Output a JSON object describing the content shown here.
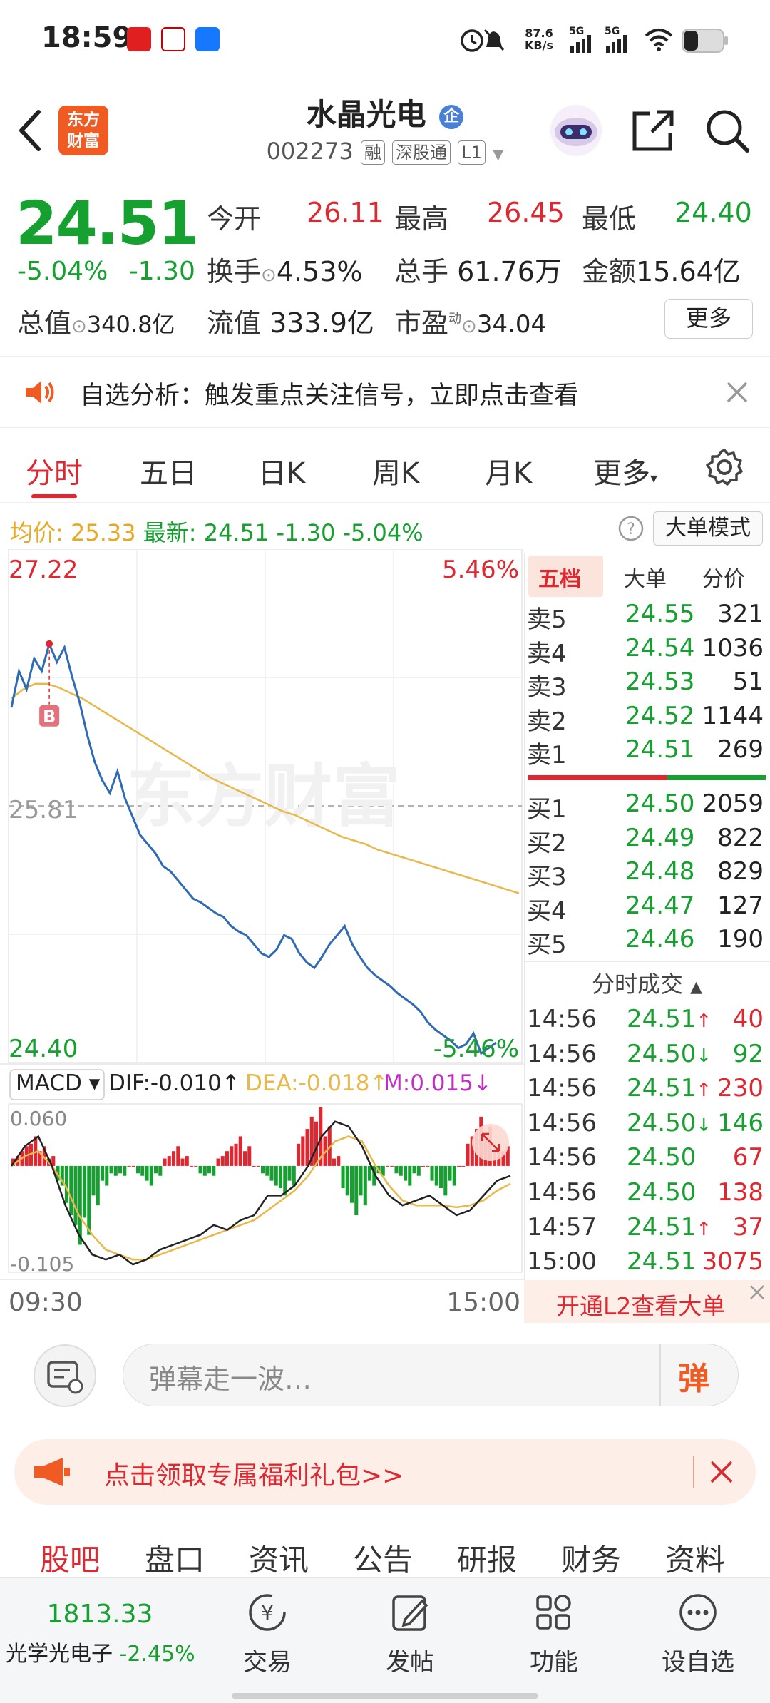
{
  "status_bar": {
    "time": "18:59",
    "net_speed": "87.6",
    "net_unit": "KB/s",
    "signal1": "5G",
    "signal2": "5G"
  },
  "header": {
    "logo_line1": "东方",
    "logo_line2": "财富",
    "stock_name": "水晶光电",
    "badge": "企",
    "stock_code": "002273",
    "tags": [
      "融",
      "深股通",
      "L1"
    ]
  },
  "quote": {
    "price": "24.51",
    "change_pct": "-5.04%",
    "change_amt": "-1.30",
    "open_label": "今开",
    "open": "26.11",
    "high_label": "最高",
    "high": "26.45",
    "low_label": "最低",
    "low": "24.40",
    "turnover_label": "换手",
    "turnover": "4.53%",
    "volume_label": "总手",
    "volume": "61.76万",
    "amount_label": "金额",
    "amount": "15.64亿",
    "mktcap_label": "总值",
    "mktcap": "340.8亿",
    "float_label": "流值",
    "float": "333.9亿",
    "pe_label": "市盈",
    "pe_sup": "动",
    "pe": "34.04",
    "more_label": "更多"
  },
  "notice": {
    "text": "自选分析：触发重点关注信号，立即点击查看"
  },
  "chart_tabs": {
    "items": [
      "分时",
      "五日",
      "日K",
      "周K",
      "月K",
      "更多"
    ],
    "active": 0
  },
  "avg_row": {
    "avg_label": "均价:",
    "avg_value": "25.33",
    "latest_label": "最新:",
    "latest_value": "24.51",
    "latest_chg": "-1.30",
    "latest_pct": "-5.04%",
    "big_order_mode": "大单模式"
  },
  "chart_data": [
    {
      "type": "line",
      "series": [],
      "y_top_label": "27.22",
      "y_mid_label": "25.81",
      "y_bottom_label": "24.40",
      "pct_top_label": "5.46%",
      "pct_bottom_label": "-5.46%",
      "ylim": [
        24.4,
        27.22
      ],
      "x_start_label": "09:30",
      "x_end_label": "15:00",
      "marker_label": "B",
      "watermark": "东方财富",
      "price_series": [
        26.35,
        26.55,
        26.45,
        26.62,
        26.55,
        26.7,
        26.6,
        26.68,
        26.52,
        26.38,
        26.2,
        26.05,
        25.95,
        25.88,
        26.0,
        25.85,
        25.75,
        25.65,
        25.6,
        25.55,
        25.48,
        25.45,
        25.4,
        25.35,
        25.3,
        25.28,
        25.25,
        25.22,
        25.2,
        25.15,
        25.12,
        25.1,
        25.05,
        25.0,
        24.98,
        25.02,
        25.1,
        25.08,
        25.0,
        24.95,
        24.92,
        24.98,
        25.05,
        25.1,
        25.15,
        25.05,
        24.98,
        24.92,
        24.88,
        24.85,
        24.82,
        24.78,
        24.75,
        24.72,
        24.68,
        24.62,
        24.58,
        24.55,
        24.52,
        24.48,
        24.5,
        24.56,
        24.45,
        24.48,
        24.51
      ],
      "avg_series": [
        26.4,
        26.45,
        26.48,
        26.48,
        26.46,
        26.43,
        26.4,
        26.36,
        26.32,
        26.28,
        26.24,
        26.2,
        26.16,
        26.12,
        26.08,
        26.04,
        26.0,
        25.96,
        25.93,
        25.9,
        25.87,
        25.84,
        25.81,
        25.78,
        25.76,
        25.73,
        25.7,
        25.67,
        25.64,
        25.62,
        25.6,
        25.57,
        25.55,
        25.53,
        25.51,
        25.49,
        25.47,
        25.45,
        25.43,
        25.41,
        25.39,
        25.37,
        25.35,
        25.33
      ]
    },
    {
      "type": "bar",
      "series": [],
      "indicator": "MACD",
      "dif_label": "DIF:-0.010↑",
      "dea_label": "DEA:-0.018↑",
      "m_label": "M:0.015↓",
      "y_top_label": "0.060",
      "y_bottom_label": "-0.105",
      "ylim": [
        -0.105,
        0.06
      ],
      "macd_values": [
        0.01,
        0.02,
        0.03,
        0.02,
        0.01,
        -0.02,
        -0.05,
        -0.08,
        -0.07,
        -0.04,
        -0.02,
        -0.01,
        -0.01,
        0.0,
        -0.01,
        -0.02,
        -0.01,
        0.01,
        0.02,
        0.01,
        0.0,
        -0.01,
        -0.01,
        0.01,
        0.02,
        0.03,
        0.02,
        0.0,
        -0.01,
        -0.02,
        -0.03,
        -0.02,
        0.03,
        0.05,
        0.06,
        0.04,
        0.01,
        -0.03,
        -0.05,
        -0.04,
        -0.02,
        -0.01,
        0.0,
        -0.01,
        -0.02,
        -0.01,
        0.0,
        -0.02,
        -0.03,
        -0.02,
        0.0,
        0.03,
        0.05,
        0.04,
        0.02,
        0.02
      ],
      "dif_series": [
        0.0,
        0.02,
        0.03,
        0.0,
        -0.04,
        -0.07,
        -0.09,
        -0.095,
        -0.09,
        -0.1,
        -0.095,
        -0.085,
        -0.08,
        -0.075,
        -0.07,
        -0.06,
        -0.065,
        -0.055,
        -0.05,
        -0.03,
        -0.03,
        -0.02,
        0.0,
        0.03,
        0.045,
        0.04,
        0.02,
        -0.01,
        -0.03,
        -0.04,
        -0.035,
        -0.03,
        -0.04,
        -0.05,
        -0.045,
        -0.03,
        -0.015,
        -0.01
      ],
      "dea_series": [
        0.0,
        0.01,
        0.015,
        0.0,
        -0.02,
        -0.05,
        -0.07,
        -0.085,
        -0.09,
        -0.095,
        -0.095,
        -0.09,
        -0.085,
        -0.08,
        -0.075,
        -0.07,
        -0.065,
        -0.06,
        -0.055,
        -0.045,
        -0.035,
        -0.025,
        -0.01,
        0.01,
        0.025,
        0.03,
        0.025,
        0.0,
        -0.02,
        -0.035,
        -0.04,
        -0.04,
        -0.04,
        -0.042,
        -0.04,
        -0.035,
        -0.025,
        -0.018
      ]
    }
  ],
  "panel": {
    "tabs": [
      "五档",
      "大单",
      "分价"
    ],
    "sells": [
      {
        "label": "卖5",
        "price": "24.55",
        "vol": "321"
      },
      {
        "label": "卖4",
        "price": "24.54",
        "vol": "1036"
      },
      {
        "label": "卖3",
        "price": "24.53",
        "vol": "51"
      },
      {
        "label": "卖2",
        "price": "24.52",
        "vol": "1144"
      },
      {
        "label": "卖1",
        "price": "24.51",
        "vol": "269"
      }
    ],
    "buys": [
      {
        "label": "买1",
        "price": "24.50",
        "vol": "2059"
      },
      {
        "label": "买2",
        "price": "24.49",
        "vol": "822"
      },
      {
        "label": "买3",
        "price": "24.48",
        "vol": "829"
      },
      {
        "label": "买4",
        "price": "24.47",
        "vol": "127"
      },
      {
        "label": "买5",
        "price": "24.46",
        "vol": "190"
      }
    ],
    "ticks_title": "分时成交",
    "ticks": [
      {
        "time": "14:56",
        "price": "24.51",
        "arrow": "↑",
        "vol": "40",
        "color": "#e0262e"
      },
      {
        "time": "14:56",
        "price": "24.50",
        "arrow": "↓",
        "vol": "92",
        "color": "#15a030"
      },
      {
        "time": "14:56",
        "price": "24.51",
        "arrow": "↑",
        "vol": "230",
        "color": "#e0262e"
      },
      {
        "time": "14:56",
        "price": "24.50",
        "arrow": "↓",
        "vol": "146",
        "color": "#15a030"
      },
      {
        "time": "14:56",
        "price": "24.50",
        "arrow": "",
        "vol": "67",
        "color": "#e0262e"
      },
      {
        "time": "14:56",
        "price": "24.50",
        "arrow": "",
        "vol": "138",
        "color": "#e0262e"
      },
      {
        "time": "14:57",
        "price": "24.51",
        "arrow": "↑",
        "vol": "37",
        "color": "#e0262e"
      },
      {
        "time": "15:00",
        "price": "24.51",
        "arrow": "",
        "vol": "3075",
        "color": "#e0262e"
      }
    ],
    "l2_text": "开通L2查看大单"
  },
  "comment": {
    "placeholder": "弹幕走一波…",
    "danmu_btn": "弹"
  },
  "promo": {
    "text": "点击领取专属福利礼包>>"
  },
  "subtabs": {
    "items": [
      "股吧",
      "盘口",
      "资讯",
      "公告",
      "研报",
      "财务",
      "资料"
    ],
    "active": 0
  },
  "bottom_bar": {
    "index_value": "1813.33",
    "index_name": "光学光电子",
    "index_pct": "-2.45%",
    "items": [
      "交易",
      "发帖",
      "功能",
      "设自选"
    ]
  },
  "colors": {
    "up": "#e0262e",
    "down": "#15a030",
    "accent": "#f05a23",
    "avg_line": "#e8b84a",
    "price_line": "#2f6bb5"
  }
}
